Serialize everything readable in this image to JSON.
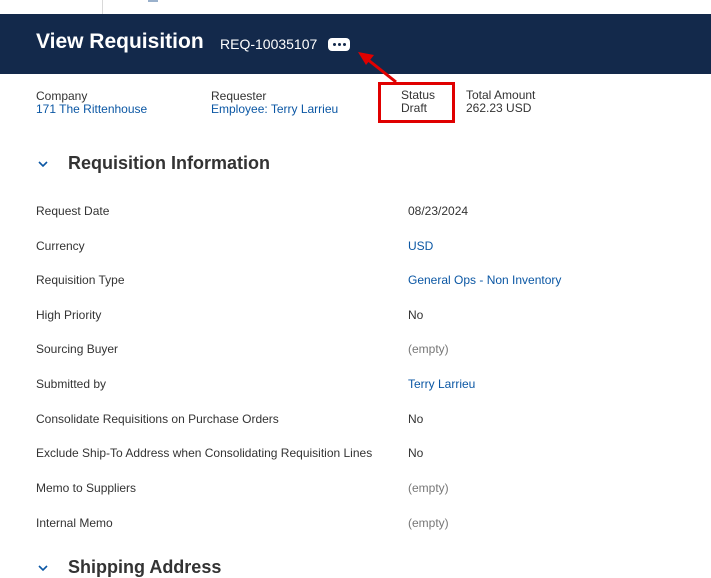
{
  "header": {
    "title": "View Requisition",
    "requisition_id": "REQ-10035107"
  },
  "summary": {
    "company_label": "Company",
    "company_value": "171 The Rittenhouse",
    "requester_label": "Requester",
    "requester_value": "Employee: Terry Larrieu",
    "status_label": "Status",
    "status_value": "Draft",
    "total_label": "Total Amount",
    "total_value": "262.23 USD"
  },
  "sections": {
    "requisition_info": {
      "title": "Requisition Information"
    },
    "shipping_address": {
      "title": "Shipping Address"
    }
  },
  "fields": [
    {
      "label": "Request Date",
      "value": "08/23/2024",
      "style": "plain"
    },
    {
      "label": "Currency",
      "value": "USD",
      "style": "link"
    },
    {
      "label": "Requisition Type",
      "value": "General Ops - Non Inventory",
      "style": "link"
    },
    {
      "label": "High Priority",
      "value": "No",
      "style": "plain"
    },
    {
      "label": "Sourcing Buyer",
      "value": "(empty)",
      "style": "empty"
    },
    {
      "label": "Submitted by",
      "value": "Terry Larrieu",
      "style": "link"
    },
    {
      "label": "Consolidate Requisitions on Purchase Orders",
      "value": "No",
      "style": "plain"
    },
    {
      "label": "Exclude Ship-To Address when Consolidating Requisition Lines",
      "value": "No",
      "style": "plain"
    },
    {
      "label": "Memo to Suppliers",
      "value": "(empty)",
      "style": "empty"
    },
    {
      "label": "Internal Memo",
      "value": "(empty)",
      "style": "empty"
    }
  ],
  "icons": {
    "more": "more-dots-icon",
    "chevron": "chevron-down-icon",
    "annotation": "red-arrow-annotation"
  },
  "colors": {
    "header_bg": "#13294b",
    "link": "#0b57a4",
    "highlight": "#e00000"
  }
}
